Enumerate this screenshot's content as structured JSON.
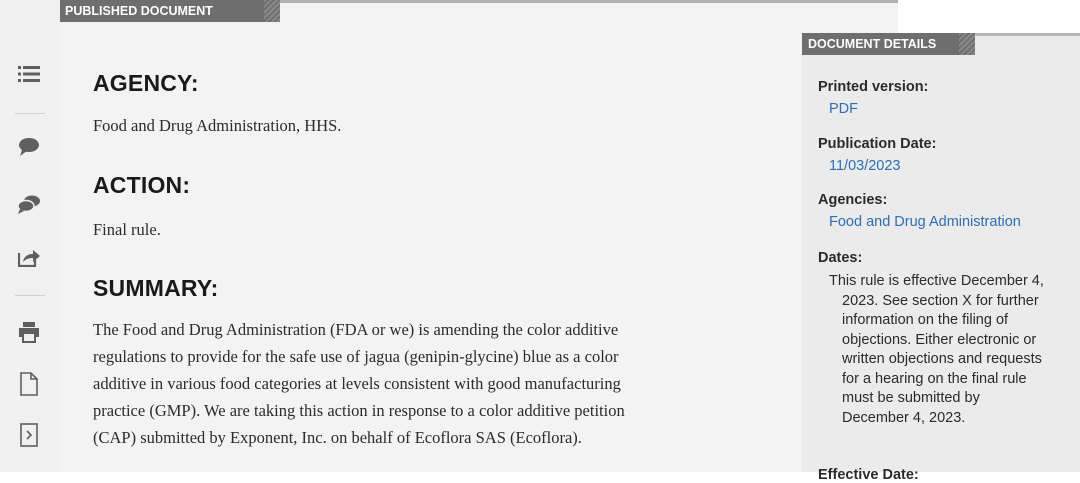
{
  "main": {
    "tab_label": "PUBLISHED DOCUMENT",
    "sections": {
      "agency": {
        "heading": "AGENCY:",
        "text": "Food and Drug Administration, HHS."
      },
      "action": {
        "heading": "ACTION:",
        "text": "Final rule."
      },
      "summary": {
        "heading": "SUMMARY:",
        "lines": [
          "The Food and Drug Administration (FDA or we) is amending the color additive",
          "regulations to provide for the safe use of jagua (genipin-glycine) blue as a color",
          "additive in various food categories at levels consistent with good manufacturing",
          "practice (GMP). We are taking this action in response to a color additive petition",
          "(CAP) submitted by Exponent, Inc. on behalf of Ecoflora SAS (Ecoflora)."
        ]
      }
    }
  },
  "details": {
    "tab_label": "DOCUMENT DETAILS",
    "printed_version": {
      "label": "Printed version:",
      "value": "PDF"
    },
    "publication_date": {
      "label": "Publication Date:",
      "value": "11/03/2023"
    },
    "agencies": {
      "label": "Agencies:",
      "value": "Food and Drug Administration"
    },
    "dates": {
      "label": "Dates:",
      "first_line": "This rule is effective December 4,",
      "rest_lines": [
        "2023. See section X for further",
        "information on the filing of",
        "objections. Either electronic or",
        "written objections and requests",
        "for a hearing on the final rule",
        "must be submitted by",
        "December 4, 2023."
      ]
    },
    "effective_date": {
      "label": "Effective Date:"
    }
  },
  "sidebar": {
    "icons": [
      "list-icon",
      "comment-icon",
      "comments-icon",
      "share-icon",
      "print-icon",
      "document-icon",
      "next-document-icon"
    ]
  },
  "colors": {
    "tab_bg": "#6e6e6e",
    "link": "#2f6db5",
    "sidebar_icon": "#5f5f5f"
  }
}
